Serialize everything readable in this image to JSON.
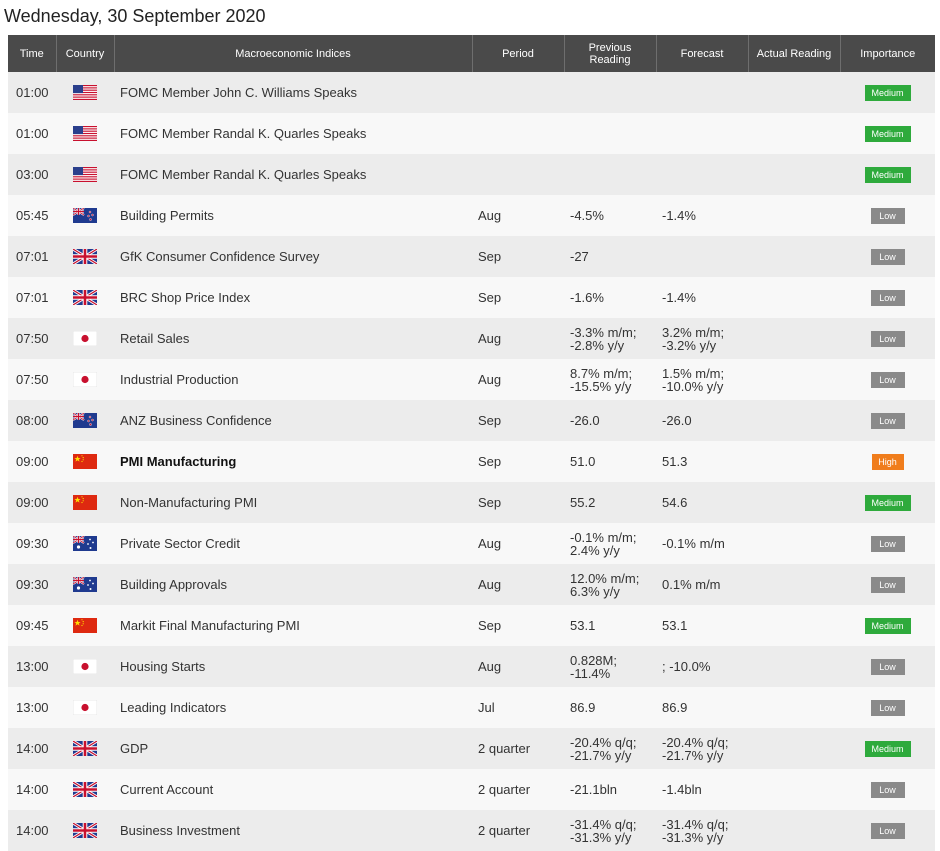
{
  "page": {
    "date": "Wednesday, 30 September 2020"
  },
  "columns": {
    "time": "Time",
    "country": "Country",
    "indices": "Macroeconomic Indices",
    "period": "Period",
    "previous_line1": "Previous",
    "previous_line2": "Reading",
    "forecast": "Forecast",
    "actual": "Actual Reading",
    "importance": "Importance"
  },
  "flags": {
    "us": "us-flag-icon",
    "nz": "nz-flag-icon",
    "au": "au-flag-icon",
    "gb": "gb-flag-icon",
    "jp": "jp-flag-icon",
    "cn": "cn-flag-icon"
  },
  "colors": {
    "medium": "#2eaa3c",
    "low": "#8a8a8a",
    "high": "#f07d1c",
    "header": "#4a4a4a"
  },
  "rows": [
    {
      "time": "01:00",
      "country": "us",
      "event": "FOMC Member John C. Williams Speaks",
      "period": "",
      "prev1": "",
      "prev2": "",
      "fc1": "",
      "fc2": "",
      "actual": "",
      "importance": "Medium",
      "level": "medium"
    },
    {
      "time": "01:00",
      "country": "us",
      "event": "FOMC Member Randal K. Quarles Speaks",
      "period": "",
      "prev1": "",
      "prev2": "",
      "fc1": "",
      "fc2": "",
      "actual": "",
      "importance": "Medium",
      "level": "medium"
    },
    {
      "time": "03:00",
      "country": "us",
      "event": "FOMC Member Randal K. Quarles Speaks",
      "period": "",
      "prev1": "",
      "prev2": "",
      "fc1": "",
      "fc2": "",
      "actual": "",
      "importance": "Medium",
      "level": "medium"
    },
    {
      "time": "05:45",
      "country": "nz",
      "event": "Building Permits",
      "period": "Aug",
      "prev1": "-4.5%",
      "prev2": "",
      "fc1": "-1.4%",
      "fc2": "",
      "actual": "",
      "importance": "Low",
      "level": "low"
    },
    {
      "time": "07:01",
      "country": "gb",
      "event": "GfK Consumer Confidence Survey",
      "period": "Sep",
      "prev1": "-27",
      "prev2": "",
      "fc1": "",
      "fc2": "",
      "actual": "",
      "importance": "Low",
      "level": "low"
    },
    {
      "time": "07:01",
      "country": "gb",
      "event": "BRC Shop Price Index",
      "period": "Sep",
      "prev1": "-1.6%",
      "prev2": "",
      "fc1": "-1.4%",
      "fc2": "",
      "actual": "",
      "importance": "Low",
      "level": "low"
    },
    {
      "time": "07:50",
      "country": "jp",
      "event": "Retail Sales",
      "period": "Aug",
      "prev1": "-3.3% m/m;",
      "prev2": "-2.8% y/y",
      "fc1": "3.2% m/m;",
      "fc2": "-3.2% y/y",
      "actual": "",
      "importance": "Low",
      "level": "low"
    },
    {
      "time": "07:50",
      "country": "jp",
      "event": "Industrial Production",
      "period": "Aug",
      "prev1": "8.7% m/m;",
      "prev2": "-15.5% y/y",
      "fc1": "1.5% m/m;",
      "fc2": "-10.0% y/y",
      "actual": "",
      "importance": "Low",
      "level": "low"
    },
    {
      "time": "08:00",
      "country": "nz",
      "event": "ANZ Business Confidence",
      "period": "Sep",
      "prev1": "-26.0",
      "prev2": "",
      "fc1": "-26.0",
      "fc2": "",
      "actual": "",
      "importance": "Low",
      "level": "low"
    },
    {
      "time": "09:00",
      "country": "cn",
      "event": "PMI Manufacturing",
      "bold": true,
      "period": "Sep",
      "prev1": "51.0",
      "prev2": "",
      "fc1": "51.3",
      "fc2": "",
      "actual": "",
      "importance": "High",
      "level": "high"
    },
    {
      "time": "09:00",
      "country": "cn",
      "event": "Non-Manufacturing PMI",
      "period": "Sep",
      "prev1": "55.2",
      "prev2": "",
      "fc1": "54.6",
      "fc2": "",
      "actual": "",
      "importance": "Medium",
      "level": "medium"
    },
    {
      "time": "09:30",
      "country": "au",
      "event": "Private Sector Credit",
      "period": "Aug",
      "prev1": "-0.1% m/m;",
      "prev2": "2.4% y/y",
      "fc1": "-0.1% m/m",
      "fc2": "",
      "actual": "",
      "importance": "Low",
      "level": "low"
    },
    {
      "time": "09:30",
      "country": "au",
      "event": "Building Approvals",
      "period": "Aug",
      "prev1": "12.0% m/m;",
      "prev2": "6.3% y/y",
      "fc1": "0.1% m/m",
      "fc2": "",
      "actual": "",
      "importance": "Low",
      "level": "low"
    },
    {
      "time": "09:45",
      "country": "cn",
      "event": "Markit Final Manufacturing PMI",
      "period": "Sep",
      "prev1": "53.1",
      "prev2": "",
      "fc1": "53.1",
      "fc2": "",
      "actual": "",
      "importance": "Medium",
      "level": "medium"
    },
    {
      "time": "13:00",
      "country": "jp",
      "event": "Housing Starts",
      "period": "Aug",
      "prev1": "0.828M;",
      "prev2": "-11.4%",
      "fc1": "; -10.0%",
      "fc2": "",
      "actual": "",
      "importance": "Low",
      "level": "low"
    },
    {
      "time": "13:00",
      "country": "jp",
      "event": "Leading Indicators",
      "period": "Jul",
      "prev1": "86.9",
      "prev2": "",
      "fc1": "86.9",
      "fc2": "",
      "actual": "",
      "importance": "Low",
      "level": "low"
    },
    {
      "time": "14:00",
      "country": "gb",
      "event": "GDP",
      "period": "2 quarter",
      "prev1": "-20.4% q/q;",
      "prev2": "-21.7% y/y",
      "fc1": "-20.4% q/q;",
      "fc2": "-21.7% y/y",
      "actual": "",
      "importance": "Medium",
      "level": "medium"
    },
    {
      "time": "14:00",
      "country": "gb",
      "event": "Current Account",
      "period": "2 quarter",
      "prev1": "-21.1bln",
      "prev2": "",
      "fc1": "-1.4bln",
      "fc2": "",
      "actual": "",
      "importance": "Low",
      "level": "low"
    },
    {
      "time": "14:00",
      "country": "gb",
      "event": "Business Investment",
      "period": "2 quarter",
      "prev1": "-31.4% q/q;",
      "prev2": "-31.3% y/y",
      "fc1": "-31.4% q/q;",
      "fc2": "-31.3% y/y",
      "actual": "",
      "importance": "Low",
      "level": "low"
    }
  ]
}
